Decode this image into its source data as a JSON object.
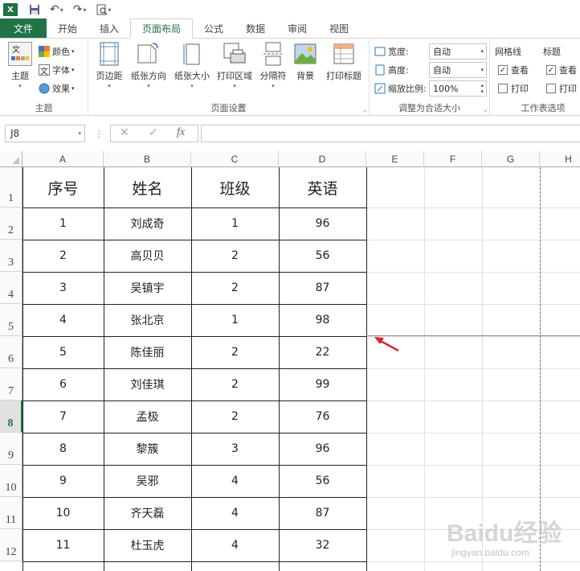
{
  "quick_access": {
    "app_icon": "X"
  },
  "tabs": [
    {
      "label": "文件"
    },
    {
      "label": "开始"
    },
    {
      "label": "插入"
    },
    {
      "label": "页面布局"
    },
    {
      "label": "公式"
    },
    {
      "label": "数据"
    },
    {
      "label": "审阅"
    },
    {
      "label": "视图"
    }
  ],
  "ribbon": {
    "theme_group": {
      "label": "主题",
      "theme_btn": "主题",
      "colors_btn": "颜色",
      "fonts_btn": "字体",
      "effects_btn": "效果"
    },
    "page_setup_group": {
      "label": "页面设置",
      "margins": "页边距",
      "orientation": "纸张方向",
      "size": "纸张大小",
      "print_area": "打印区域",
      "breaks": "分隔符",
      "background": "背景",
      "print_titles": "打印标题"
    },
    "scale_group": {
      "label": "调整为合适大小",
      "width_label": "宽度:",
      "width_value": "自动",
      "height_label": "高度:",
      "height_value": "自动",
      "scale_label": "缩放比例:",
      "scale_value": "100%"
    },
    "sheet_options_group": {
      "label": "工作表选项",
      "gridlines_label": "网格线",
      "gridlines_view": "查看",
      "gridlines_print": "打印",
      "headings_label": "标题",
      "headings_view": "查看",
      "headings_print": "打印"
    }
  },
  "formula_bar": {
    "name_box": "J8",
    "fx": "fx",
    "cancel": "✕",
    "enter": "✓",
    "formula": ""
  },
  "columns": [
    "A",
    "B",
    "C",
    "D",
    "E",
    "F",
    "G",
    "H"
  ],
  "rows": [
    "1",
    "2",
    "3",
    "4",
    "5",
    "6",
    "7",
    "8",
    "9",
    "10",
    "11",
    "12"
  ],
  "selected_row": "8",
  "table": {
    "headers": [
      "序号",
      "姓名",
      "班级",
      "英语"
    ],
    "rows": [
      [
        "1",
        "刘成奇",
        "1",
        "96"
      ],
      [
        "2",
        "高贝贝",
        "2",
        "56"
      ],
      [
        "3",
        "吴镇宇",
        "2",
        "87"
      ],
      [
        "4",
        "张北京",
        "1",
        "98"
      ],
      [
        "5",
        "陈佳丽",
        "2",
        "22"
      ],
      [
        "6",
        "刘佳琪",
        "2",
        "99"
      ],
      [
        "7",
        "孟极",
        "2",
        "76"
      ],
      [
        "8",
        "黎簇",
        "3",
        "96"
      ],
      [
        "9",
        "吴邪",
        "4",
        "56"
      ],
      [
        "10",
        "齐天磊",
        "4",
        "87"
      ],
      [
        "11",
        "杜玉虎",
        "4",
        "32"
      ]
    ]
  },
  "colors": {
    "excel_green": "#217346",
    "arrow_red": "#d6262b"
  },
  "watermark": {
    "main": "Baidu经验",
    "sub": "jingyan.baidu.com"
  }
}
